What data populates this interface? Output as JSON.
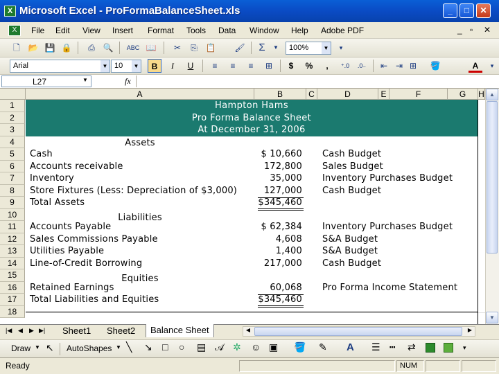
{
  "window": {
    "title": "Microsoft Excel - ProFormaBalanceSheet.xls",
    "app_icon": "X"
  },
  "menu": [
    "File",
    "Edit",
    "View",
    "Insert",
    "Format",
    "Tools",
    "Data",
    "Window",
    "Help",
    "Adobe PDF"
  ],
  "toolbar": {
    "zoom": "100%",
    "font_name": "Arial",
    "font_size": "10",
    "sum_symbol": "Σ",
    "bold": "B",
    "italic": "I",
    "underline": "U",
    "currency": "$",
    "percent": "%",
    "comma": ","
  },
  "formula_bar": {
    "name_box": "L27",
    "fx": "fx",
    "value": ""
  },
  "columns": [
    "A",
    "B",
    "C",
    "D",
    "E",
    "F",
    "G",
    "H"
  ],
  "rows": [
    "1",
    "2",
    "3",
    "4",
    "5",
    "6",
    "7",
    "8",
    "9",
    "10",
    "11",
    "12",
    "13",
    "14",
    "15",
    "16",
    "17",
    "18"
  ],
  "header": {
    "company": "Hampton Hams",
    "report": "Pro Forma Balance Sheet",
    "date": "At December 31, 2006"
  },
  "sheet": {
    "assets_heading": "Assets",
    "liabilities_heading": "Liabilities",
    "equities_heading": "Equities",
    "lines": [
      {
        "row": 5,
        "label": "Cash",
        "amount": "$  10,660",
        "source": "Cash Budget"
      },
      {
        "row": 6,
        "label": "Accounts receivable",
        "amount": "172,800",
        "source": "Sales Budget"
      },
      {
        "row": 7,
        "label": "Inventory",
        "amount": "35,000",
        "source": "Inventory Purchases Budget"
      },
      {
        "row": 8,
        "label": "Store Fixtures (Less: Depreciation of  $3,000)",
        "amount": "127,000",
        "source": "Cash Budget"
      },
      {
        "row": 9,
        "label": "Total Assets",
        "amount": "$345,460",
        "source": ""
      },
      {
        "row": 11,
        "label": "Accounts Payable",
        "amount": "$  62,384",
        "source": "Inventory Purchases Budget"
      },
      {
        "row": 12,
        "label": "Sales Commissions Payable",
        "amount": "4,608",
        "source": "S&A Budget"
      },
      {
        "row": 13,
        "label": "Utilities Payable",
        "amount": "1,400",
        "source": "S&A Budget"
      },
      {
        "row": 14,
        "label": "Line-of-Credit Borrowing",
        "amount": "217,000",
        "source": "Cash Budget"
      },
      {
        "row": 16,
        "label": "Retained Earnings",
        "amount": "60,068",
        "source": "Pro Forma Income Statement"
      },
      {
        "row": 17,
        "label": "Total Liabilities and Equities",
        "amount": "$345,460",
        "source": ""
      }
    ]
  },
  "tabs": [
    "Sheet1",
    "Sheet2",
    "Balance Sheet"
  ],
  "drawbar": {
    "draw": "Draw",
    "autoshapes": "AutoShapes"
  },
  "status": {
    "text": "Ready",
    "num": "NUM"
  },
  "colors": {
    "title_blue": "#0a4bc4",
    "header_band": "#1b7a6f"
  }
}
